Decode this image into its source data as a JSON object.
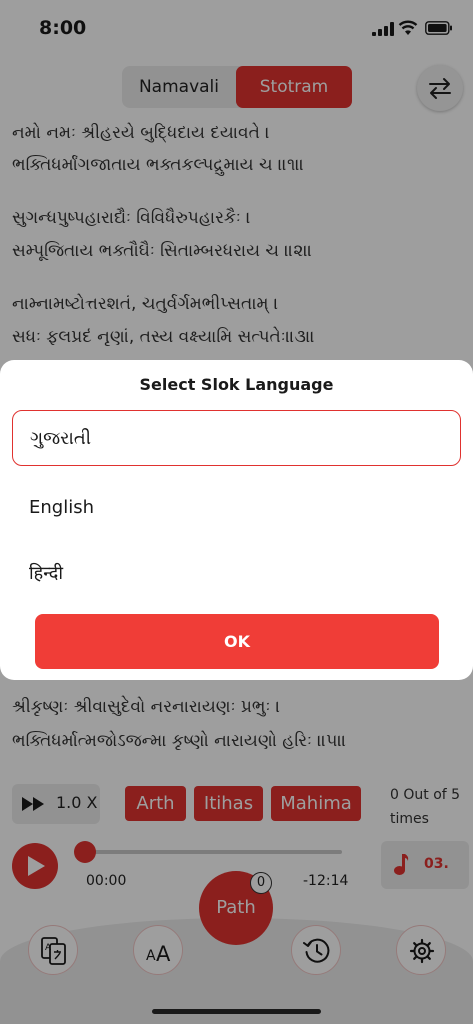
{
  "status_bar": {
    "time": "8:00"
  },
  "tabs": [
    {
      "label": "Namavali",
      "selected": false
    },
    {
      "label": "Stotram",
      "selected": true
    }
  ],
  "icons": {
    "swap": "swap-arrows-icon",
    "signal": "cellular-signal-icon",
    "wifi": "wifi-icon",
    "battery": "battery-icon",
    "fast_forward": "fast-forward-icon",
    "play": "play-icon",
    "music": "music-note-icon",
    "translate": "translate-icon",
    "font_size": "font-size-icon",
    "history": "history-icon",
    "settings": "gear-icon"
  },
  "verses": [
    "નમો નમઃ શ્રીહરયે બુદ્ધિદાય દયાવતે ।",
    "ભક્તિધર્માંગજાતાય ભક્તકલ્પદ્રુમાય ચ ॥૧॥",
    "સુગન્ધપુષ્પહારાદ્યૈઃ   વિવિધૈરુપહારકૈઃ ।",
    "સમ્પૂજિતાય ભક્તૌઘૈઃ  સિતામ્બરધરાય ચ ॥૨॥",
    "નામ્નામષ્ટોત્તરશતં,   ચતુર્વર્ગમભીપ્સતામ્ ।",
    "સધઃ ફલપ્રદં નૃણાં, તસ્ય વક્ષ્યામિ સત્પતેઃ॥૩॥",
    "શ્રીકૃષ્ણઃ શ્રીવાસુદેવો   નરનારાયણઃ  પ્રભુઃ ।",
    "ભક્તિધર્માત્મજોઽજન્મા કૃષ્ણો નારાયણો  હરિઃ ॥૫॥"
  ],
  "modal": {
    "title": "Select Slok Language",
    "options": [
      {
        "label": "ગુજરાતી",
        "selected": true
      },
      {
        "label": "English",
        "selected": false
      },
      {
        "label": "हिन्दी",
        "selected": false
      }
    ],
    "ok_label": "OK"
  },
  "player": {
    "speed": "1.0 X",
    "chips": [
      "Arth",
      "Itihas",
      "Mahima"
    ],
    "count_text": "0 Out of 5 times",
    "elapsed": "00:00",
    "remaining": "-12:14",
    "track": "03.",
    "progress": 0
  },
  "bottom_bar": {
    "path_label": "Path",
    "path_count": "0"
  },
  "colors": {
    "accent": "#e0322f",
    "ok_button": "#f03d37",
    "overlay": "rgba(0,0,0,0.38)"
  }
}
